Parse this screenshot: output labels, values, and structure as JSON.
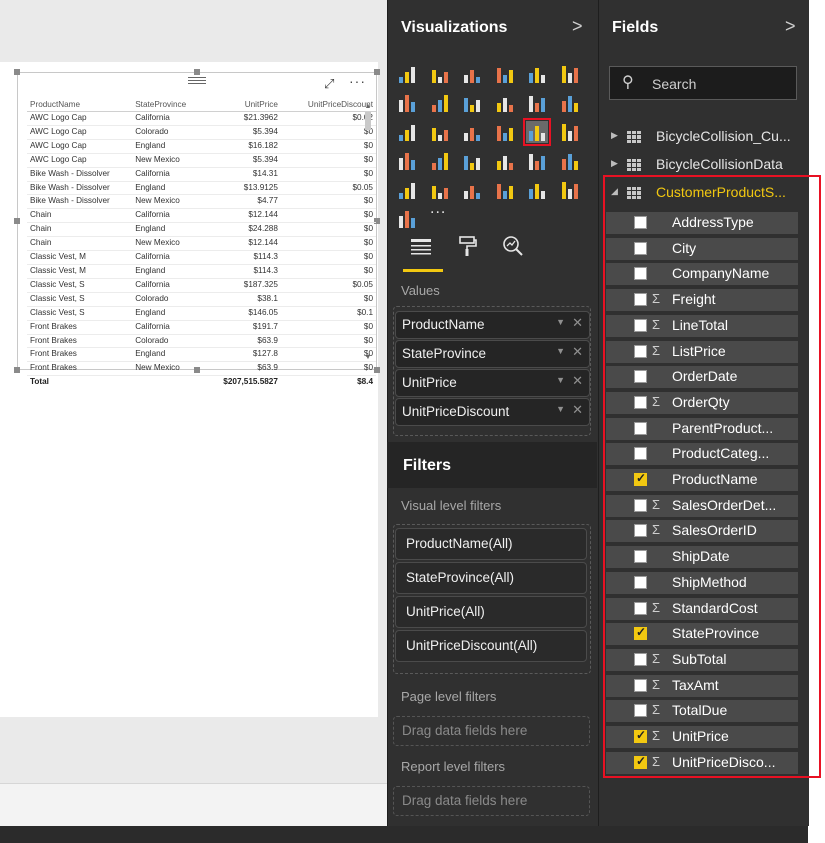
{
  "visualizations": {
    "title": "Visualizations",
    "chevron": ">",
    "tab_icons": [
      "fields-tab-icon",
      "format-paint-roller-icon",
      "analytics-magnifier-icon"
    ],
    "values_label": "Values",
    "values": [
      {
        "label": "ProductName"
      },
      {
        "label": "StateProvince"
      },
      {
        "label": "UnitPrice"
      },
      {
        "label": "UnitPriceDiscount"
      }
    ],
    "more_visuals": "..."
  },
  "filters": {
    "title": "Filters",
    "visual_level_label": "Visual level filters",
    "visual_level": [
      {
        "label": "ProductName(All)"
      },
      {
        "label": "StateProvince(All)"
      },
      {
        "label": "UnitPrice(All)"
      },
      {
        "label": "UnitPriceDiscount(All)"
      }
    ],
    "page_level_label": "Page level filters",
    "page_drag": "Drag data fields here",
    "report_level_label": "Report level filters",
    "report_drag": "Drag data fields here"
  },
  "fields": {
    "title": "Fields",
    "chevron": ">",
    "search_placeholder": "Search",
    "tables": [
      {
        "name": "BicycleCollision_Cu...",
        "expanded": false
      },
      {
        "name": "BicycleCollisionData",
        "expanded": false
      },
      {
        "name": "CustomerProductS...",
        "expanded": true
      }
    ],
    "columns": [
      {
        "name": "AddressType",
        "sigma": false,
        "checked": false
      },
      {
        "name": "City",
        "sigma": false,
        "checked": false
      },
      {
        "name": "CompanyName",
        "sigma": false,
        "checked": false
      },
      {
        "name": "Freight",
        "sigma": true,
        "checked": false
      },
      {
        "name": "LineTotal",
        "sigma": true,
        "checked": false
      },
      {
        "name": "ListPrice",
        "sigma": true,
        "checked": false
      },
      {
        "name": "OrderDate",
        "sigma": false,
        "checked": false
      },
      {
        "name": "OrderQty",
        "sigma": true,
        "checked": false
      },
      {
        "name": "ParentProduct...",
        "sigma": false,
        "checked": false
      },
      {
        "name": "ProductCateg...",
        "sigma": false,
        "checked": false
      },
      {
        "name": "ProductName",
        "sigma": false,
        "checked": true
      },
      {
        "name": "SalesOrderDet...",
        "sigma": true,
        "checked": false
      },
      {
        "name": "SalesOrderID",
        "sigma": true,
        "checked": false
      },
      {
        "name": "ShipDate",
        "sigma": false,
        "checked": false
      },
      {
        "name": "ShipMethod",
        "sigma": false,
        "checked": false
      },
      {
        "name": "StandardCost",
        "sigma": true,
        "checked": false
      },
      {
        "name": "StateProvince",
        "sigma": false,
        "checked": true
      },
      {
        "name": "SubTotal",
        "sigma": true,
        "checked": false
      },
      {
        "name": "TaxAmt",
        "sigma": true,
        "checked": false
      },
      {
        "name": "TotalDue",
        "sigma": true,
        "checked": false
      },
      {
        "name": "UnitPrice",
        "sigma": true,
        "checked": true
      },
      {
        "name": "UnitPriceDisco...",
        "sigma": true,
        "checked": true
      }
    ]
  },
  "table_visual": {
    "headers": [
      "ProductName",
      "StateProvince",
      "UnitPrice",
      "UnitPriceDiscount"
    ],
    "rows": [
      [
        "AWC Logo Cap",
        "California",
        "$21.3962",
        "$0.02"
      ],
      [
        "AWC Logo Cap",
        "Colorado",
        "$5.394",
        "$0"
      ],
      [
        "AWC Logo Cap",
        "England",
        "$16.182",
        "$0"
      ],
      [
        "AWC Logo Cap",
        "New Mexico",
        "$5.394",
        "$0"
      ],
      [
        "Bike Wash - Dissolver",
        "California",
        "$14.31",
        "$0"
      ],
      [
        "Bike Wash - Dissolver",
        "England",
        "$13.9125",
        "$0.05"
      ],
      [
        "Bike Wash - Dissolver",
        "New Mexico",
        "$4.77",
        "$0"
      ],
      [
        "Chain",
        "California",
        "$12.144",
        "$0"
      ],
      [
        "Chain",
        "England",
        "$24.288",
        "$0"
      ],
      [
        "Chain",
        "New Mexico",
        "$12.144",
        "$0"
      ],
      [
        "Classic Vest, M",
        "California",
        "$114.3",
        "$0"
      ],
      [
        "Classic Vest, M",
        "England",
        "$114.3",
        "$0"
      ],
      [
        "Classic Vest, S",
        "California",
        "$187.325",
        "$0.05"
      ],
      [
        "Classic Vest, S",
        "Colorado",
        "$38.1",
        "$0"
      ],
      [
        "Classic Vest, S",
        "England",
        "$146.05",
        "$0.1"
      ],
      [
        "Front Brakes",
        "California",
        "$191.7",
        "$0"
      ],
      [
        "Front Brakes",
        "Colorado",
        "$63.9",
        "$0"
      ],
      [
        "Front Brakes",
        "England",
        "$127.8",
        "$0"
      ],
      [
        "Front Brakes",
        "New Mexico",
        "$63.9",
        "$0"
      ]
    ],
    "total": [
      "Total",
      "",
      "$207,515.5827",
      "$8.4"
    ],
    "more_options": "···"
  },
  "colors": {
    "pane_bg": "#303030",
    "accent_yellow": "#f2c811",
    "highlight_red": "#e81123"
  }
}
